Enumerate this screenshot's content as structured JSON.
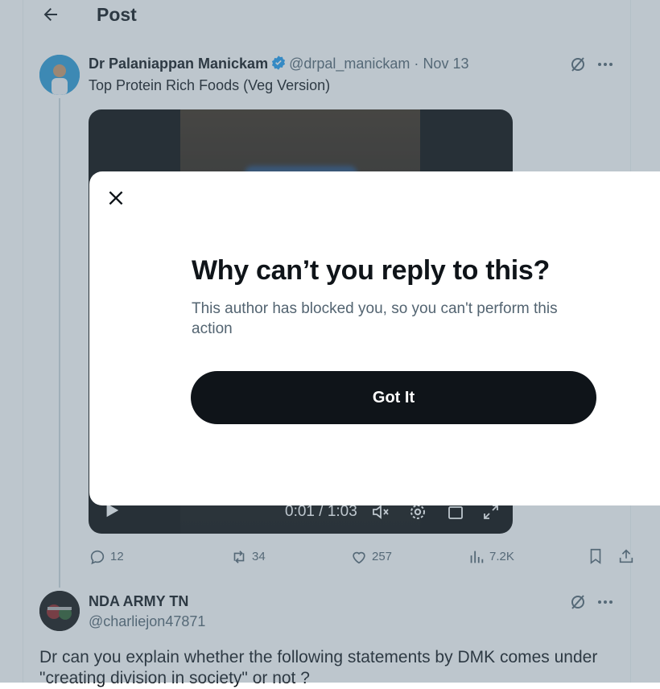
{
  "header": {
    "title": "Post",
    "back_icon": "arrow-left-icon"
  },
  "post": {
    "author_name": "Dr Palaniappan Manickam",
    "handle": "@drpal_manickam",
    "separator": "·",
    "date": "Nov 13",
    "text": "Top Protein Rich Foods (Veg Version)",
    "video": {
      "time": "0:01 / 1:03"
    },
    "actions": {
      "replies": "12",
      "reposts": "34",
      "likes": "257",
      "views": "7.2K"
    }
  },
  "reply": {
    "author_name": "NDA ARMY TN",
    "handle": "@charliejon47871",
    "text": "Dr can you explain whether the following statements by DMK comes under \"creating division in society\" or not ?"
  },
  "dialog": {
    "title": "Why can’t you reply to this?",
    "message": "This author has blocked you, so you can't perform this action",
    "button_label": "Got It"
  },
  "colors": {
    "accent_blue": "#1d9bf0",
    "text_primary": "#0f1419",
    "text_secondary": "#536471",
    "overlay": "rgba(91,112,131,0.40)"
  }
}
